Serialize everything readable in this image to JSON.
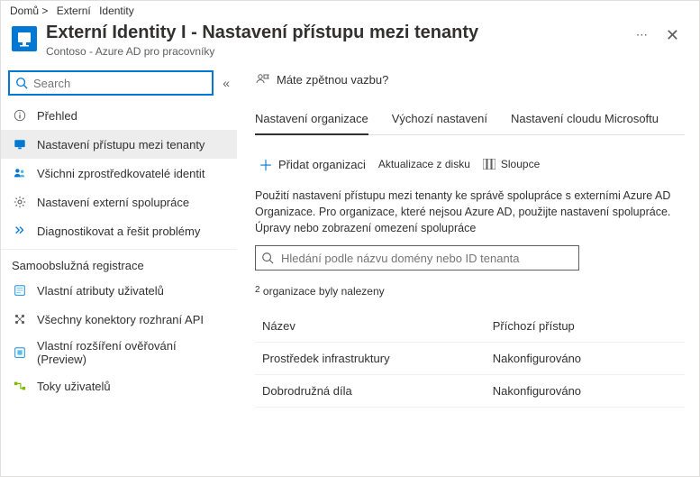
{
  "breadcrumb": {
    "home": "Domů >",
    "external": "Externí",
    "identity": "Identity"
  },
  "header": {
    "title": "Externí   Identity I - Nastavení přístupu mezi tenanty",
    "subtitle": "Contoso - Azure AD pro pracovníky"
  },
  "sidebar": {
    "search_placeholder": "Search",
    "items": {
      "overview": "Přehled",
      "cross_tenant": "Nastavení přístupu mezi tenanty",
      "all_idp": "Všichni zprostředkovatelé identit",
      "ext_collab": "Nastavení externí spolupráce",
      "diagnose": "Diagnostikovat a řešit problémy"
    },
    "section": "Samoobslužná registrace",
    "items2": {
      "custom_attrs": "Vlastní atributy uživatelů",
      "api_connectors": "Všechny konektory rozhraní API",
      "custom_auth": "Vlastní rozšíření ověřování (Preview)",
      "user_flows": "Toky uživatelů"
    }
  },
  "main": {
    "feedback": "Máte zpětnou vazbu?",
    "tabs": {
      "org": "Nastavení organizace",
      "default": "Výchozí nastavení",
      "mscloud": "Nastavení cloudu Microsoftu"
    },
    "toolbar": {
      "add_org": "Přidat organizaci",
      "refresh": "Aktualizace z disku",
      "columns": "Sloupce"
    },
    "description": "Použití nastavení přístupu mezi tenanty ke správě spolupráce s externími Azure AD Organizace. Pro organizace, které nejsou Azure AD, použijte nastavení spolupráce. Úpravy nebo zobrazení omezení spolupráce",
    "domain_search_placeholder": "Hledání podle názvu domény nebo ID tenanta",
    "count_prefix": "2",
    "count_text": " organizace byly nalezeny",
    "table": {
      "head_name": "Název",
      "head_inbound": "Příchozí přístup",
      "rows": [
        {
          "name": "Prostředek infrastruktury",
          "inbound": "Nakonfigurováno"
        },
        {
          "name": "Dobrodružná díla",
          "inbound": "Nakonfigurováno"
        }
      ]
    }
  }
}
